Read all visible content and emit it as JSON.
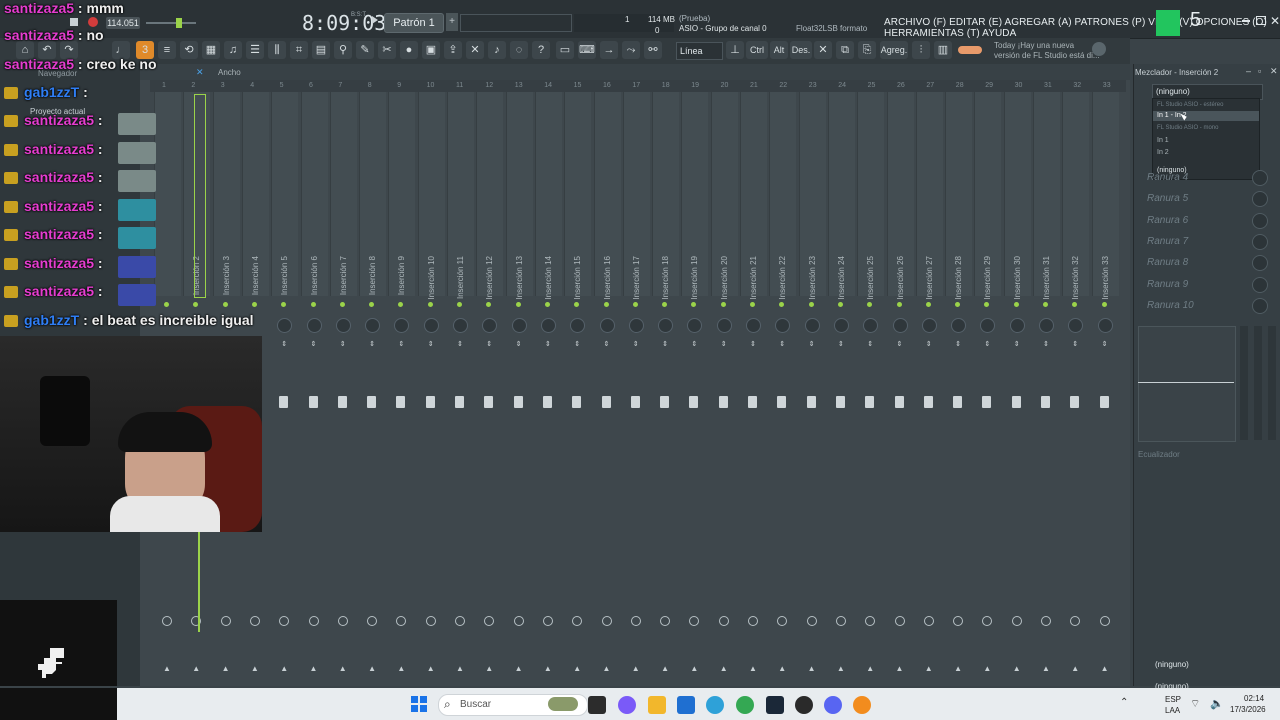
{
  "window": {
    "menu_text": "ARCHIVO (F) EDITAR (E) AGREGAR (A) PATRONES (P) VISTA (V) OPCIONES (O) HERRAMIENTAS (T) AYUDA",
    "clock": "8:09:03",
    "clock_suffix": "B:S:T",
    "bpm": "114.051",
    "pattern_label": "Patrón 1",
    "memory": "114 MB",
    "cpu_line1": "1",
    "cpu_line2": "0",
    "audio_info_line1": "(Prueba)",
    "audio_info_line2": "ASIO - Grupo de canal 0",
    "audio_format": "Float32LSB formato",
    "snap_label": "Línea",
    "news_line1": "Today  ¡Hay una nueva",
    "news_line2": "versión de FL Studio está di..."
  },
  "toolbar2": {
    "labels": [
      "Ctrl",
      "Alt",
      "Des.",
      "Agreg."
    ]
  },
  "browser": {
    "navigator_label": "Navegador",
    "project_label": "Proyecto actual",
    "width_label": "Ancho"
  },
  "chat": [
    {
      "user": "santizaza5",
      "message": "mmm"
    },
    {
      "user": "santizaza5",
      "message": "no"
    },
    {
      "user": "santizaza5",
      "message": "creo ke no"
    },
    {
      "user": "gab1zzT",
      "message": ""
    },
    {
      "user": "santizaza5",
      "message": ""
    },
    {
      "user": "santizaza5",
      "message": ""
    },
    {
      "user": "santizaza5",
      "message": ""
    },
    {
      "user": "santizaza5",
      "message": ""
    },
    {
      "user": "santizaza5",
      "message": ""
    },
    {
      "user": "santizaza5",
      "message": ""
    },
    {
      "user": "santizaza5",
      "message": ""
    },
    {
      "user": "gab1zzT",
      "message": "el beat es increible igual"
    }
  ],
  "mixer": {
    "ruler_numbers": [
      "1",
      "2",
      "3",
      "4",
      "5",
      "6",
      "7",
      "8",
      "9",
      "10",
      "11",
      "12",
      "13",
      "14",
      "15",
      "16",
      "17",
      "18",
      "19",
      "20",
      "21",
      "22",
      "23",
      "24",
      "25",
      "26",
      "27",
      "28",
      "29",
      "30",
      "31",
      "32",
      "33"
    ],
    "inserts": [
      "Inserción 2",
      "Inserción 3",
      "Inserción 4",
      "Inserción 5",
      "Inserción 6",
      "Inserción 7",
      "Inserción 8",
      "Inserción 9",
      "Inserción 10",
      "Inserción 11",
      "Inserción 12",
      "Inserción 13",
      "Inserción 14",
      "Inserción 15",
      "Inserción 16",
      "Inserción 17",
      "Inserción 18",
      "Inserción 19",
      "Inserción 20",
      "Inserción 21",
      "Inserción 22",
      "Inserción 23",
      "Inserción 24",
      "Inserción 25",
      "Inserción 26",
      "Inserción 27",
      "Inserción 28",
      "Inserción 29",
      "Inserción 30",
      "Inserción 31",
      "Inserción 32",
      "Inserción 33"
    ]
  },
  "right_panel": {
    "title": "Mezclador - Inserción 2",
    "input_select": "(ninguno)",
    "dropdown": {
      "header1": "FL Studio ASIO - estéreo",
      "selected": "In 1 - In 2",
      "header2": "FL Studio ASIO - mono",
      "item1": "In 1",
      "item2": "In 2",
      "none": "(ninguno)"
    },
    "slots": [
      "Ranura 4",
      "Ranura 5",
      "Ranura 6",
      "Ranura 7",
      "Ranura 8",
      "Ranura 9",
      "Ranura 10"
    ],
    "eq_label": "Ecualizador",
    "output_select": "(ninguno)",
    "output_select2": "(ninguno)"
  },
  "taskbar": {
    "search_placeholder": "Buscar",
    "lang1": "ESP",
    "lang2": "LAA",
    "time": "02:14",
    "date": "17/3/2026"
  },
  "colors": {
    "accent_green": "#9bd34a",
    "chat_user_pink": "#e63dd0",
    "chat_user_blue": "#2f7ef5",
    "fl_logo_green": "#22c55e"
  }
}
